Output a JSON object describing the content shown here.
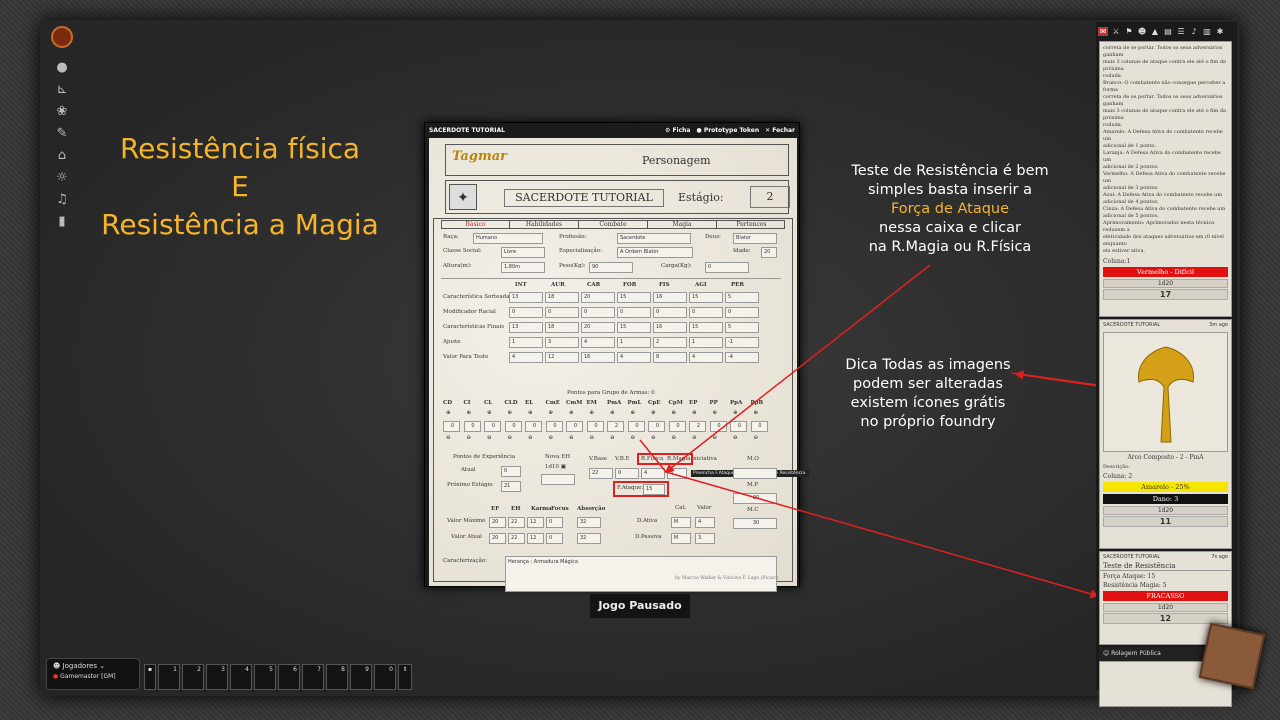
{
  "promo": {
    "line1": "Resistência física",
    "line2": "E",
    "line3": "Resistência a Magia"
  },
  "tip1": {
    "l1": "Teste de Resistência é bem",
    "l2": "simples basta inserir a",
    "l3": "Força de Ataque",
    "l4": "nessa caixa e clicar",
    "l5": "na R.Magia ou R.Física"
  },
  "tip2": {
    "l1": "Dica Todas as imagens",
    "l2": "podem ser alteradas",
    "l3": "existem ícones grátis",
    "l4": "no próprio foundry"
  },
  "sheet": {
    "title": "SACERDOTE TUTORIAL",
    "ficha": "Ficha",
    "token": "Prototype Token",
    "close": "Fechar",
    "logo": "Tagmar",
    "personagem": "Personagem",
    "charname": "SACERDOTE TUTORIAL",
    "estagio_label": "Estágio:",
    "estagio": "2",
    "tabs": [
      "Básico",
      "Habilidades",
      "Combate",
      "Magia",
      "Pertences"
    ],
    "raca_l": "Raça:",
    "raca": "Humano",
    "prof_l": "Profissão:",
    "prof": "Sacerdote",
    "deus_l": "Deus:",
    "deus": "Blator",
    "classe_l": "Classe Social:",
    "classe": "Livre",
    "espec_l": "Especialização:",
    "espec": "A Ordem Blator",
    "idade_l": "Idade:",
    "idade": "20",
    "altura_l": "Altura(m):",
    "altura": "1,80m",
    "peso_l": "Peso(Kg):",
    "peso": "90",
    "carga_l": "Carga(Kg):",
    "carga": "0",
    "attrs": [
      "INT",
      "AUR",
      "CAR",
      "FOR",
      "FIS",
      "AGI",
      "PER"
    ],
    "rows": [
      {
        "l": "Característica Sorteada",
        "v": [
          "13",
          "18",
          "20",
          "15",
          "16",
          "15",
          "5"
        ]
      },
      {
        "l": "Modificador Racial",
        "v": [
          "0",
          "0",
          "0",
          "0",
          "0",
          "0",
          "0"
        ]
      },
      {
        "l": "Características Finais",
        "v": [
          "13",
          "18",
          "20",
          "15",
          "16",
          "15",
          "5"
        ]
      },
      {
        "l": "Ajuste",
        "v": [
          "1",
          "3",
          "4",
          "1",
          "2",
          "1",
          "-1"
        ]
      },
      {
        "l": "Valor Para Teste",
        "v": [
          "4",
          "12",
          "16",
          "4",
          "8",
          "4",
          "-4"
        ]
      }
    ],
    "grupos_title": "Pontos para Grupo de Armas: 0",
    "grupos": [
      "CD",
      "CI",
      "CL",
      "CLD",
      "EL",
      "CmE",
      "CmM",
      "EM",
      "PmA",
      "PmL",
      "CpE",
      "CpM",
      "EP",
      "PP",
      "PpA",
      "PpB"
    ],
    "grupos_v": [
      "0",
      "0",
      "0",
      "0",
      "0",
      "0",
      "0",
      "0",
      "2",
      "0",
      "0",
      "0",
      "2",
      "0",
      "0",
      "0"
    ],
    "exp_title": "Pontos de Experiência",
    "atual_l": "Atual",
    "atual": "0",
    "prox_l": "Próximo Estágio",
    "prox": "21",
    "novaeh_l": "Nova EH",
    "novaeh": "1d10",
    "vbase_l": "V.Base",
    "vbe_l": "V.B.E",
    "rfis_l": "R.Física",
    "rmag_l": "R.Magia",
    "iniciativa_l": "Iniciativa",
    "vbase": "22",
    "vbe": "0",
    "rfis": "4",
    "rmag": "5",
    "fatq_l": "F.Ataque:",
    "fatq": "15",
    "tooltip": "Preencha F.Ataque para rolar Teste de Resistência.",
    "mo_l": "M.O",
    "mp_l": "M.P",
    "mp": "20",
    "mc_l": "M.C",
    "mc": "30",
    "ef_cols": [
      "EF",
      "EH",
      "Karma",
      "Focus",
      "Absorção"
    ],
    "vmax_l": "Valor Máximo",
    "vmax": [
      "20",
      "22",
      "12",
      "0",
      "32"
    ],
    "vatu_l": "Valor Atual",
    "vatu": [
      "20",
      "22",
      "12",
      "0",
      "32"
    ],
    "cat_l": "Cat.",
    "valor_l": "Valor",
    "dativa_l": "D.Ativa",
    "dativa": [
      "M",
      "4"
    ],
    "dpass_l": "D.Passiva",
    "dpass": [
      "M",
      "3"
    ],
    "caract_l": "Caracterização:",
    "heranca": "Herança : Armadura Mágica",
    "credits": "by Marcos Walker & Vinicius F. Lago (Picaro)"
  },
  "chat": {
    "card1": {
      "lines": [
        "correta de se portar. Todos os seus adversários ganham",
        "mais 3 colunas de ataque contra ele até o fim da próxima",
        "rodada.",
        "Branco: O combatente não consegue perceber a forma",
        "correta de se portar. Todos os seus adversários ganham",
        "mais 3 colunas de ataque contra ele até o fim da próxima",
        "rodada.",
        "Amarelo: A Defesa Ativa do combatente recebe um",
        "adicional de 1 ponto.",
        "Laranja: A Defesa Ativa do combatente recebe um",
        "adicional de 2 pontos.",
        "Vermelho: A Defesa Ativa do combatente recebe um",
        "adicional de 3 pontos.",
        "Azul: A Defesa Ativa do combatente recebe um",
        "adicional de 4 pontos.",
        "Cinza: A Defesa Ativa do combatente recebe um",
        "adicional de 5 pontos.",
        "Aprimoramento: Aprimorados nesta técnica reduzem a",
        "efetividade dos ataques adversários em (0 nível enquanto",
        "ela estiver ativa."
      ],
      "coluna": "Coluna:1",
      "result": "Vermelho - Difícil",
      "formula": "1d20",
      "total": "17"
    },
    "card2": {
      "speaker": "SACERDOTE TUTORIAL",
      "time": "3m ago",
      "item": "Arco Composto - 2 - PmA",
      "desc": "Descrição:",
      "coluna": "Coluna: 2",
      "result": "Amarelo - 25%",
      "dano": "Dano: 3",
      "formula": "1d20",
      "total": "11"
    },
    "card3": {
      "speaker": "SACERDOTE TUTORIAL",
      "time": "7s ago",
      "title": "Teste de Resistência",
      "forca": "Força Ataque: 15",
      "resist": "Resistência Magia: 5",
      "result": "FRACASSO",
      "formula": "1d20",
      "total": "12"
    },
    "rollmode": "Rolagem Pública"
  },
  "players": {
    "title": "Jogadores",
    "gm": "Gamemaster [GM]"
  },
  "hotbar": [
    "1",
    "2",
    "3",
    "4",
    "5",
    "6",
    "7",
    "8",
    "9",
    "0"
  ],
  "paused": "Jogo Pausado"
}
